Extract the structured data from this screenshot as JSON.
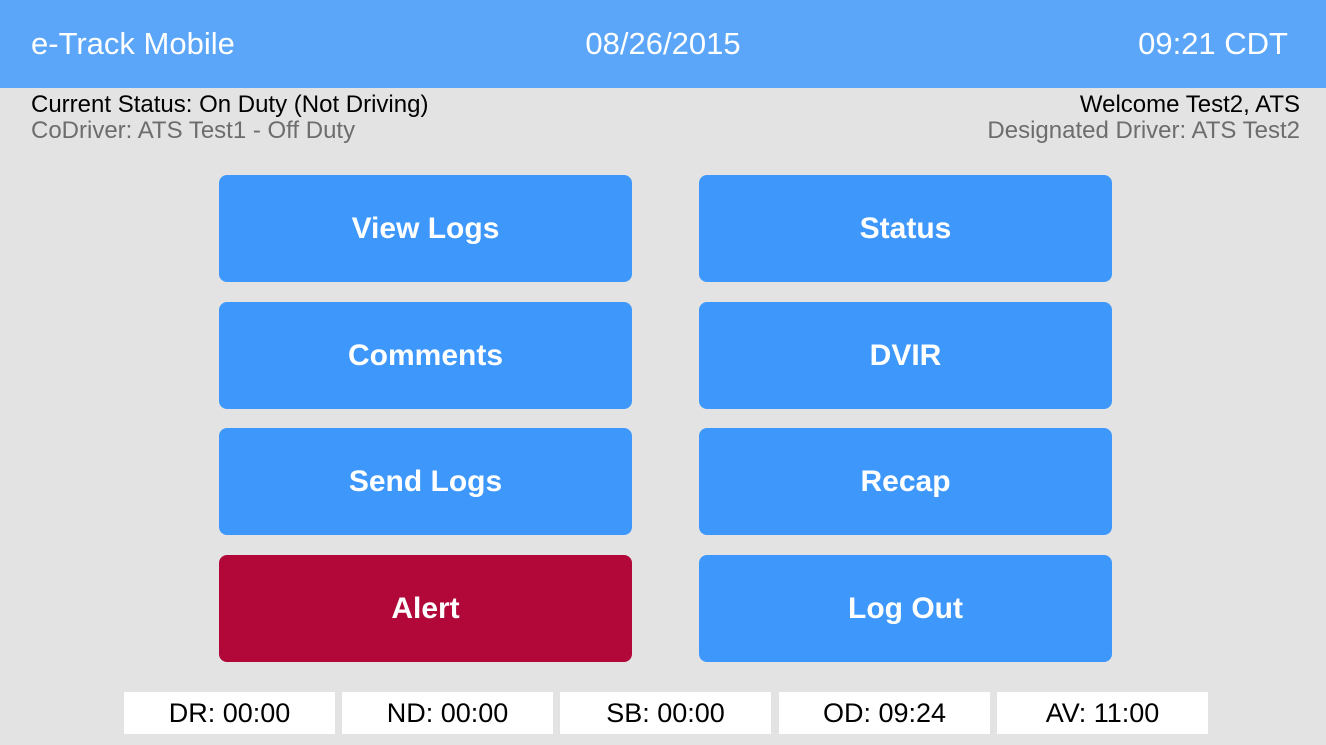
{
  "header": {
    "title": "e-Track Mobile",
    "date": "08/26/2015",
    "time": "09:21 CDT"
  },
  "info": {
    "current_status": "Current Status: On Duty (Not Driving)",
    "codriver": "CoDriver: ATS Test1 - Off Duty",
    "welcome": "Welcome Test2, ATS",
    "designated_driver": "Designated Driver: ATS Test2"
  },
  "menu": {
    "view_logs": "View Logs",
    "status": "Status",
    "comments": "Comments",
    "dvir": "DVIR",
    "send_logs": "Send Logs",
    "recap": "Recap",
    "alert": "Alert",
    "log_out": "Log Out"
  },
  "counters": {
    "dr": "DR: 00:00",
    "nd": "ND: 00:00",
    "sb": "SB: 00:00",
    "od": "OD: 09:24",
    "av": "AV: 11:00"
  },
  "colors": {
    "header_bg": "#5ba6f8",
    "button_bg": "#3e98fc",
    "alert_bg": "#b10839",
    "page_bg": "#e3e3e3"
  }
}
